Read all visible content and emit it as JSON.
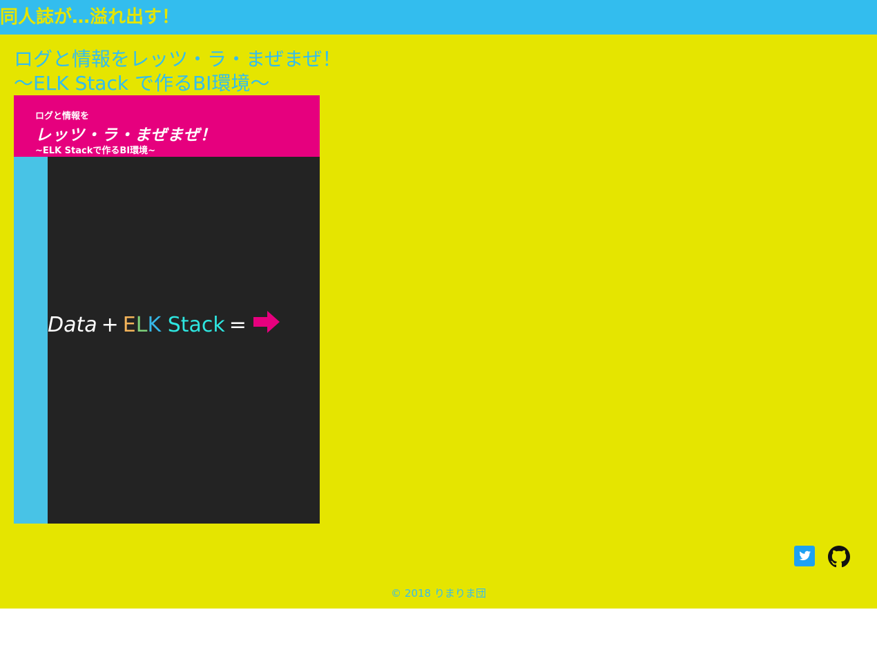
{
  "header": {
    "site_title": "同人誌が…溢れ出す！",
    "bg_color": "#33bdee",
    "title_color": "#e5e500"
  },
  "post": {
    "title_line1": "ログと情報をレッツ・ラ・まぜまぜ！",
    "title_line2": "〜ELK Stack で作るBI環境〜"
  },
  "cover": {
    "pre_title": "ログと情報を",
    "main_title": "レッツ・ラ・まぜまぜ！",
    "sub_title": "~ELK Stackで作るBI環境~",
    "formula": {
      "data": "Data",
      "plus": "+",
      "e": "E",
      "l": "L",
      "k": "K",
      "stack": "Stack",
      "equals": "="
    },
    "colors": {
      "header": "#e6007e",
      "body": "#232323",
      "side": "#48c3e6"
    }
  },
  "social": {
    "twitter_icon": "twitter-icon",
    "github_icon": "github-icon",
    "twitter_color": "#1da1f2"
  },
  "footer": {
    "copyright": "© 2018 りまりま団"
  },
  "page_bg": "#e5e500"
}
